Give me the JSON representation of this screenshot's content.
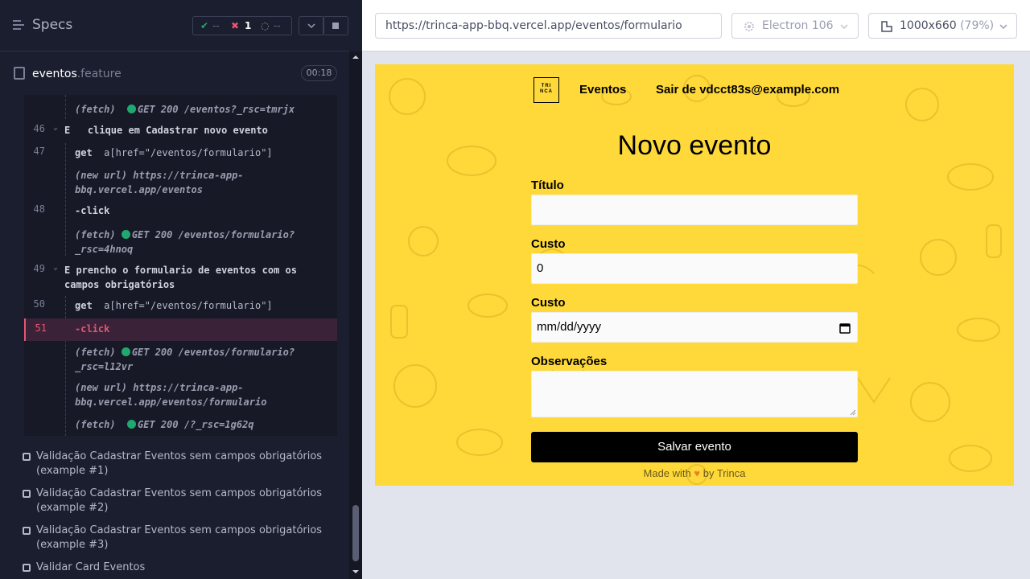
{
  "reporter": {
    "specs_label": "Specs",
    "stats": {
      "passed": "--",
      "failed": "1",
      "pending": "--"
    },
    "spec_file": {
      "name": "eventos",
      "ext": ".feature",
      "duration": "00:18"
    },
    "commands": [
      {
        "num": "",
        "text": "(fetch)",
        "extra": "GET 200 /eventos?_rsc=tmrjx",
        "type": "fetch"
      },
      {
        "num": "46",
        "text": "E   clique em Cadastrar novo evento",
        "type": "step"
      },
      {
        "num": "47",
        "text": "get",
        "extra": "a[href=\"/eventos/formulario\"]",
        "type": "cmd"
      },
      {
        "num": "",
        "text": "(new url)",
        "extra": "https://trinca-app-bbq.vercel.app/eventos",
        "type": "newurl"
      },
      {
        "num": "48",
        "text": "-click",
        "type": "cmd"
      },
      {
        "num": "",
        "text": "(fetch)",
        "extra": "GET 200 /eventos/formulario?_rsc=4hnoq",
        "type": "fetch"
      },
      {
        "num": "49",
        "text": "E   prencho o formulario de eventos com os campos obrigatórios",
        "type": "step"
      },
      {
        "num": "50",
        "text": "get",
        "extra": "a[href=\"/eventos/formulario\"]",
        "type": "cmd"
      },
      {
        "num": "51",
        "text": "-click",
        "type": "cmd-active"
      },
      {
        "num": "",
        "text": "(fetch)",
        "extra": "GET 200 /eventos/formulario?_rsc=l12vr",
        "type": "fetch"
      },
      {
        "num": "",
        "text": "(new url)",
        "extra": "https://trinca-app-bbq.vercel.app/eventos/formulario",
        "type": "newurl"
      },
      {
        "num": "",
        "text": "(fetch)",
        "extra": "GET 200 /?_rsc=1g62q",
        "type": "fetch"
      }
    ],
    "tests": [
      "Validação Cadastrar Eventos sem campos obrigatórios (example #1)",
      "Validação Cadastrar Eventos sem campos obrigatórios (example #2)",
      "Validação Cadastrar Eventos sem campos obrigatórios (example #3)",
      "Validar Card Eventos"
    ]
  },
  "aut": {
    "url": "https://trinca-app-bbq.vercel.app/eventos/formulario",
    "browser": "Electron 106",
    "viewport": "1000x660",
    "zoom": "(79%)"
  },
  "app": {
    "logo_text": "TRI NCA",
    "nav": {
      "eventos": "Eventos",
      "logout": "Sair de vdcct83s@example.com"
    },
    "title": "Novo evento",
    "fields": {
      "titulo_label": "Título",
      "titulo_value": "",
      "custo_label": "Custo",
      "custo_value": "0",
      "data_label": "Custo",
      "data_placeholder": "mm/dd/yyyy",
      "obs_label": "Observações"
    },
    "save_label": "Salvar evento",
    "footer": {
      "before": "Made with",
      "after": "by Trinca"
    }
  },
  "colors": {
    "accent_yellow": "#ffd93a",
    "fail_red": "#e45770",
    "pass_green": "#1fa971"
  }
}
